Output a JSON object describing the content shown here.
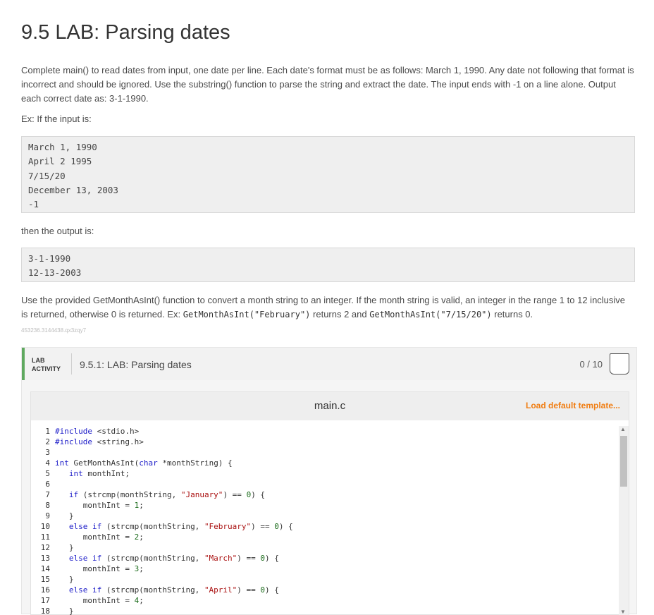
{
  "page": {
    "title": "9.5 LAB: Parsing dates",
    "intro": "Complete main() to read dates from input, one date per line. Each date's format must be as follows: March 1, 1990. Any date not following that format is incorrect and should be ignored. Use the substring() function to parse the string and extract the date. The input ends with -1 on a line alone. Output each correct date as: 3-1-1990.",
    "example_label": "Ex: If the input is:",
    "example_input": [
      "March 1, 1990",
      "April 2 1995",
      "7/15/20",
      "December 13, 2003",
      "-1"
    ],
    "output_label": "then the output is:",
    "example_output": [
      "3-1-1990",
      "12-13-2003"
    ],
    "note_prefix": "Use the provided GetMonthAsInt() function to convert a month string to an integer. If the month string is valid, an integer in the range 1 to 12 inclusive is returned, otherwise 0 is returned. Ex: ",
    "note_code1": "GetMonthAsInt(\"February\")",
    "note_mid": " returns 2 and ",
    "note_code2": "GetMonthAsInt(\"7/15/20\")",
    "note_suffix": " returns 0.",
    "meta_id": "453236.3144438.qx3zqy7"
  },
  "lab": {
    "tag_line1": "LAB",
    "tag_line2": "ACTIVITY",
    "title": "9.5.1: LAB: Parsing dates",
    "score": "0 / 10",
    "editor": {
      "filename": "main.c",
      "load_template": "Load default template..."
    }
  },
  "code_lines": [
    {
      "n": "1",
      "html": "<span class=\"kw\">#include</span> &lt;stdio.h&gt;"
    },
    {
      "n": "2",
      "html": "<span class=\"kw\">#include</span> &lt;string.h&gt;"
    },
    {
      "n": "3",
      "html": ""
    },
    {
      "n": "4",
      "html": "<span class=\"kw\">int</span> GetMonthAsInt(<span class=\"kw\">char</span> *monthString) {"
    },
    {
      "n": "5",
      "html": "   <span class=\"kw\">int</span> monthInt;"
    },
    {
      "n": "6",
      "html": ""
    },
    {
      "n": "7",
      "html": "   <span class=\"kw\">if</span> (strcmp(monthString, <span class=\"str\">\"January\"</span>) == <span class=\"num\">0</span>) {"
    },
    {
      "n": "8",
      "html": "      monthInt = <span class=\"num\">1</span>;"
    },
    {
      "n": "9",
      "html": "   }"
    },
    {
      "n": "10",
      "html": "   <span class=\"kw\">else if</span> (strcmp(monthString, <span class=\"str\">\"February\"</span>) == <span class=\"num\">0</span>) {"
    },
    {
      "n": "11",
      "html": "      monthInt = <span class=\"num\">2</span>;"
    },
    {
      "n": "12",
      "html": "   }"
    },
    {
      "n": "13",
      "html": "   <span class=\"kw\">else if</span> (strcmp(monthString, <span class=\"str\">\"March\"</span>) == <span class=\"num\">0</span>) {"
    },
    {
      "n": "14",
      "html": "      monthInt = <span class=\"num\">3</span>;"
    },
    {
      "n": "15",
      "html": "   }"
    },
    {
      "n": "16",
      "html": "   <span class=\"kw\">else if</span> (strcmp(monthString, <span class=\"str\">\"April\"</span>) == <span class=\"num\">0</span>) {"
    },
    {
      "n": "17",
      "html": "      monthInt = <span class=\"num\">4</span>;"
    },
    {
      "n": "18",
      "html": "   }"
    }
  ]
}
